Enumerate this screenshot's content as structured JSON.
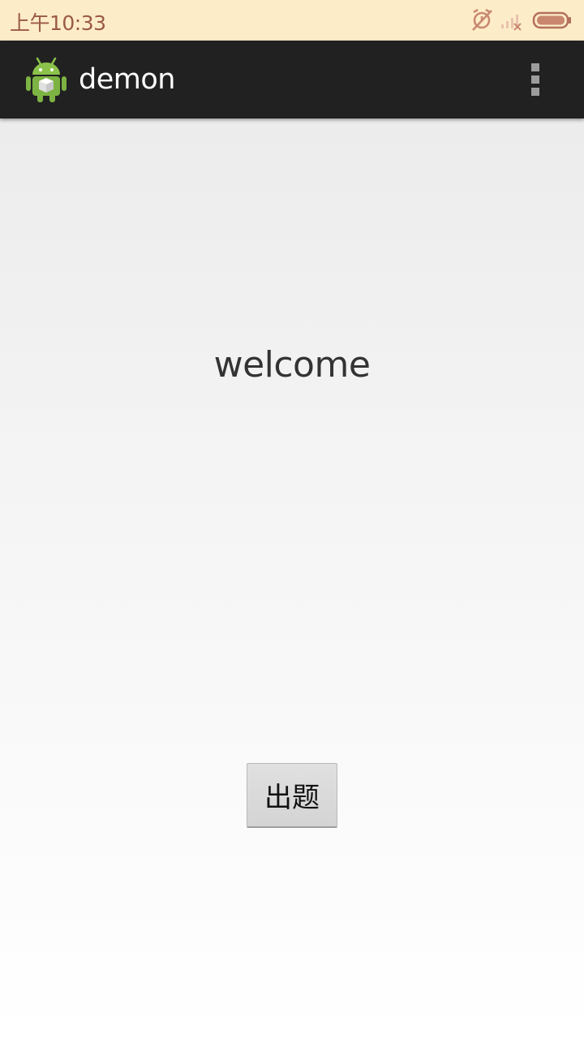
{
  "status_bar": {
    "time": "上午10:33",
    "icons": [
      "alarm-off-icon",
      "signal-no-service-icon",
      "battery-icon"
    ],
    "background_color": "#fdecc8",
    "text_color": "#9a5a45"
  },
  "action_bar": {
    "title": "demon",
    "app_icon": "android-icon",
    "menu_icon": "overflow-menu-icon",
    "background_color": "#212121"
  },
  "main": {
    "welcome_text": "welcome",
    "button_label": "出题"
  }
}
